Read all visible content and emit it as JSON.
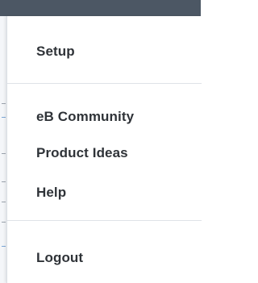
{
  "menu": {
    "items": [
      {
        "label": "Setup"
      },
      {
        "label": "eB Community"
      },
      {
        "label": "Product Ideas"
      },
      {
        "label": "Help"
      },
      {
        "label": "Logout"
      }
    ]
  },
  "colors": {
    "topbar": "#4c5764",
    "text": "#2f3338",
    "divider": "#dfe3e8"
  }
}
